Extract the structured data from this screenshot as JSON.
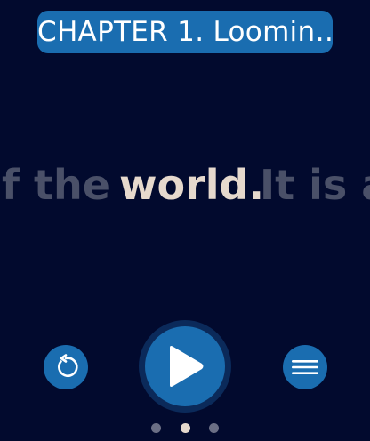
{
  "header": {
    "chapter_title": "CHAPTER 1. Loomin…"
  },
  "reader": {
    "previous_words": "of the",
    "current_word": "world.",
    "next_words": "It is a"
  },
  "controls": {
    "rewind_icon": "rewind-icon",
    "play_icon": "play-icon",
    "menu_icon": "menu-icon"
  },
  "pagination": {
    "total_pages": 3,
    "current_page": 2
  },
  "colors": {
    "background": "#020a2e",
    "accent": "#1a6db0",
    "current_word": "#e6d9cd",
    "dim_word": "#4a5068"
  }
}
